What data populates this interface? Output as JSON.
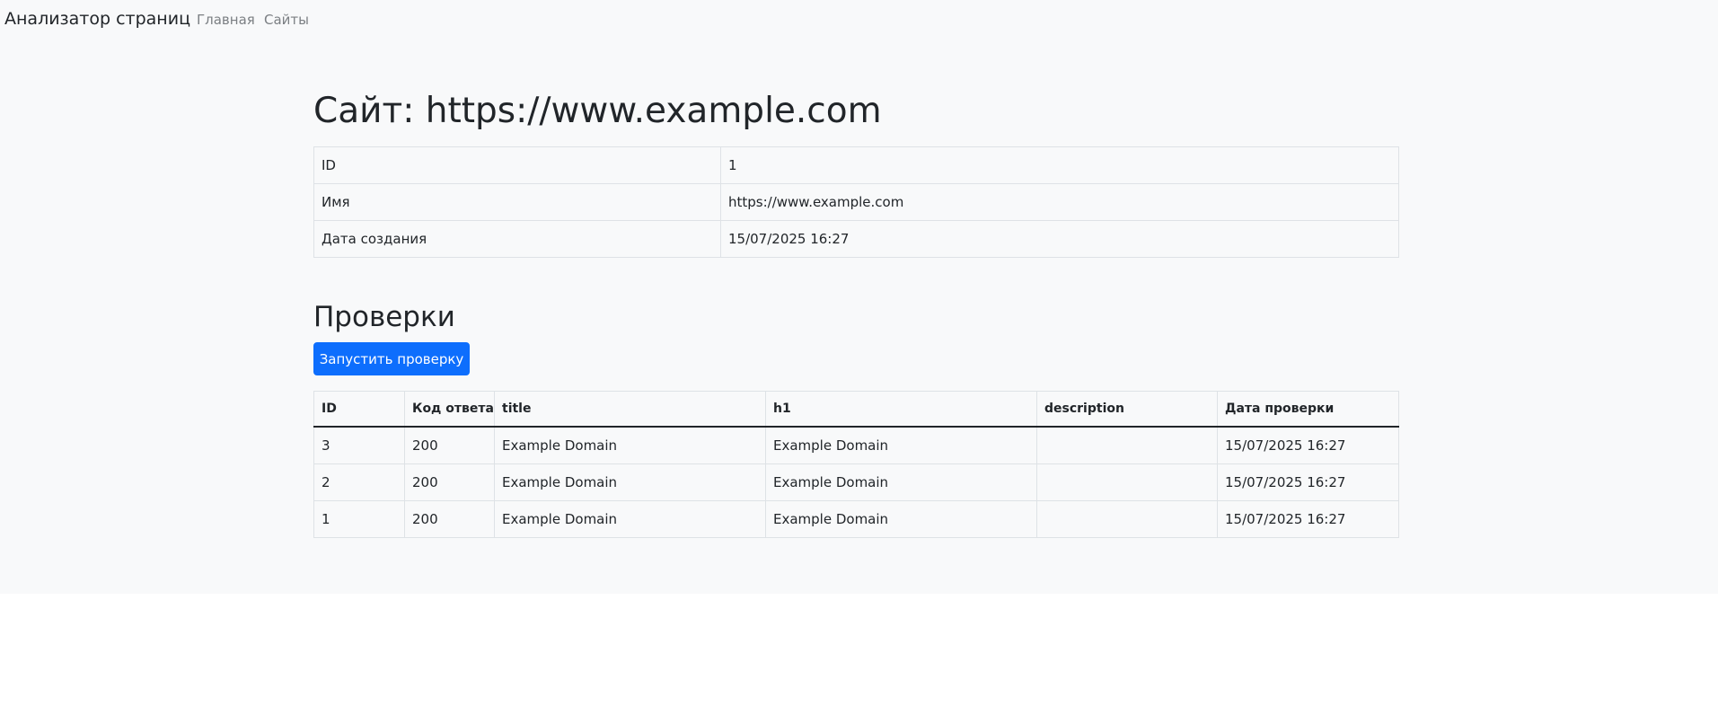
{
  "navbar": {
    "brand": "Анализатор страниц",
    "links": [
      "Главная",
      "Сайты"
    ]
  },
  "site": {
    "title": "Сайт: https://www.example.com",
    "rows": [
      {
        "label": "ID",
        "value": "1"
      },
      {
        "label": "Имя",
        "value": "https://www.example.com"
      },
      {
        "label": "Дата создания",
        "value": "15/07/2025 16:27"
      }
    ]
  },
  "checks": {
    "title": "Проверки",
    "run_button": "Запустить проверку",
    "headers": [
      "ID",
      "Код ответа",
      "title",
      "h1",
      "description",
      "Дата проверки"
    ],
    "rows": [
      [
        "3",
        "200",
        "Example Domain",
        "Example Domain",
        "",
        "15/07/2025 16:27"
      ],
      [
        "2",
        "200",
        "Example Domain",
        "Example Domain",
        "",
        "15/07/2025 16:27"
      ],
      [
        "1",
        "200",
        "Example Domain",
        "Example Domain",
        "",
        "15/07/2025 16:27"
      ]
    ]
  },
  "colors": {
    "page_background": "#f8f9fa",
    "primary_button": "#0d6efd",
    "nav_link": "#7b7f83"
  }
}
